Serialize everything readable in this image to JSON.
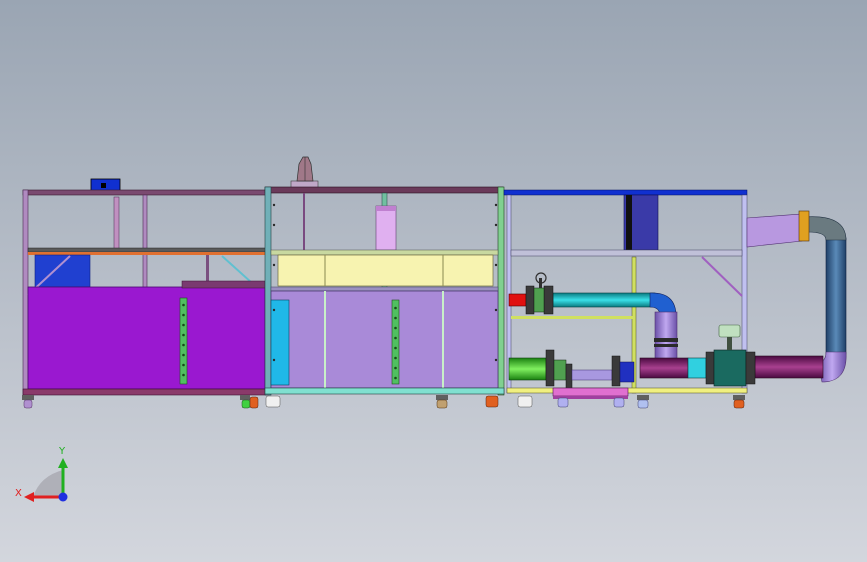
{
  "viewport": {
    "background_top": "#9aa5b3",
    "background_bottom": "#d3d6dd"
  },
  "triad": {
    "x_label": "X",
    "y_label": "Y",
    "x_color": "#e02020",
    "y_color": "#20b020",
    "z_color": "#2030e0"
  },
  "colors": {
    "frame_dark": "#6a3a5a",
    "tank_purple": "#9a18d0",
    "tank_lavender": "#a98ad8",
    "tank_yellow": "#f7f3b0",
    "pipe_teal": "#10b0b8",
    "pipe_blue": "#3a6a9a",
    "pipe_purple": "#7a1f6a",
    "pipe_green": "#3ad020",
    "pipe_red": "#e01010",
    "accent_blue": "#1030d0",
    "frame_green": "#80d080",
    "frame_yellow": "#d0e060"
  }
}
